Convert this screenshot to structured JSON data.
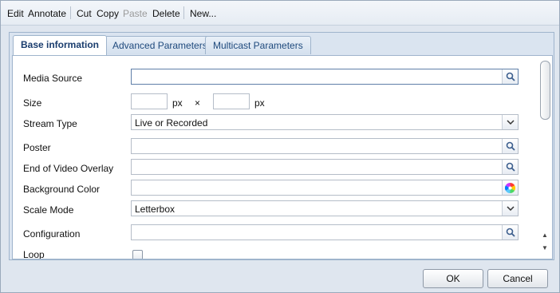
{
  "toolbar": {
    "items": [
      {
        "label": "Edit",
        "enabled": true
      },
      {
        "label": "Annotate",
        "enabled": true
      },
      {
        "label": "Cut",
        "enabled": true
      },
      {
        "label": "Copy",
        "enabled": true
      },
      {
        "label": "Paste",
        "enabled": false
      },
      {
        "label": "Delete",
        "enabled": true
      },
      {
        "label": "New...",
        "enabled": true
      }
    ]
  },
  "tabs": [
    {
      "label": "Base information",
      "active": true
    },
    {
      "label": "Advanced Parameters",
      "active": false
    },
    {
      "label": "Multicast Parameters",
      "active": false
    }
  ],
  "form": {
    "media_source": {
      "label": "Media Source",
      "value": ""
    },
    "size": {
      "label": "Size",
      "width": "",
      "height": "",
      "unit": "px",
      "separator": "×"
    },
    "stream_type": {
      "label": "Stream Type",
      "value": "Live or Recorded"
    },
    "poster": {
      "label": "Poster",
      "value": ""
    },
    "end_overlay": {
      "label": "End of Video Overlay",
      "value": ""
    },
    "background_color": {
      "label": "Background Color",
      "value": ""
    },
    "scale_mode": {
      "label": "Scale Mode",
      "value": "Letterbox"
    },
    "configuration": {
      "label": "Configuration",
      "value": ""
    },
    "loop": {
      "label": "Loop",
      "checked": false
    }
  },
  "buttons": {
    "ok": "OK",
    "cancel": "Cancel"
  },
  "icons": {
    "browse": "magnifier-icon",
    "dropdown": "chevron-down-icon",
    "color": "color-wheel-icon"
  },
  "colors": {
    "accent": "#1a3d6e",
    "panel": "#dae4f0",
    "frame": "#dfe6ef"
  }
}
